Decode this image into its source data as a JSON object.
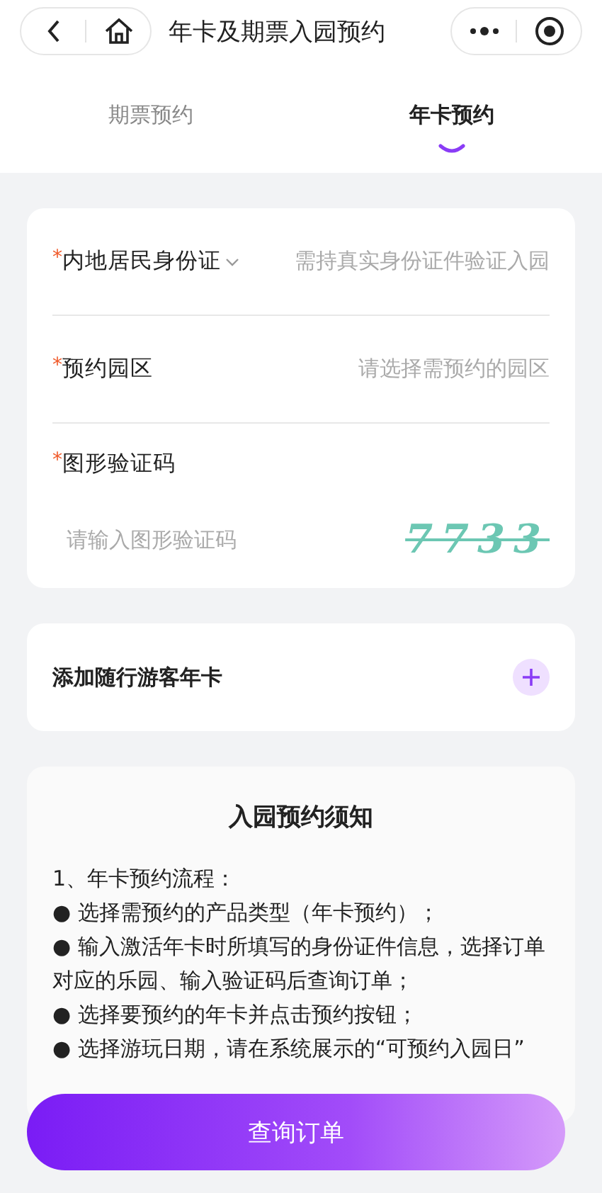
{
  "nav_bar": {
    "title": "年卡及期票入园预约"
  },
  "tabs": [
    {
      "label": "期票预约",
      "selected": false
    },
    {
      "label": "年卡预约",
      "selected": true
    }
  ],
  "form": {
    "fields": [
      {
        "kind": "select",
        "label": "内地居民身份证",
        "required_mark": "*",
        "placeholder": "需持真实身份证件验证入园"
      },
      {
        "kind": "picker",
        "label": "预约园区",
        "required_mark": "*",
        "placeholder": "请选择需预约的园区"
      },
      {
        "kind": "captcha",
        "label": "图形验证码",
        "required_mark": "*",
        "placeholder": "请输入图形验证码",
        "captcha": "7733"
      }
    ]
  },
  "companion": {
    "label": "添加随行游客年卡"
  },
  "notice": {
    "title": "入园预约须知",
    "lines": [
      "1、年卡预约流程：",
      "● 选择需预约的产品类型（年卡预约）；",
      "● 输入激活年卡时所填写的身份证件信息，选择订单对应的乐园、输入验证码后查询订单；",
      "● 选择要预约的年卡并点击预约按钮；",
      "● 选择游玩日期，请在系统展示的“可预约入园日”"
    ]
  },
  "submit_button": {
    "label": "查询订单"
  }
}
